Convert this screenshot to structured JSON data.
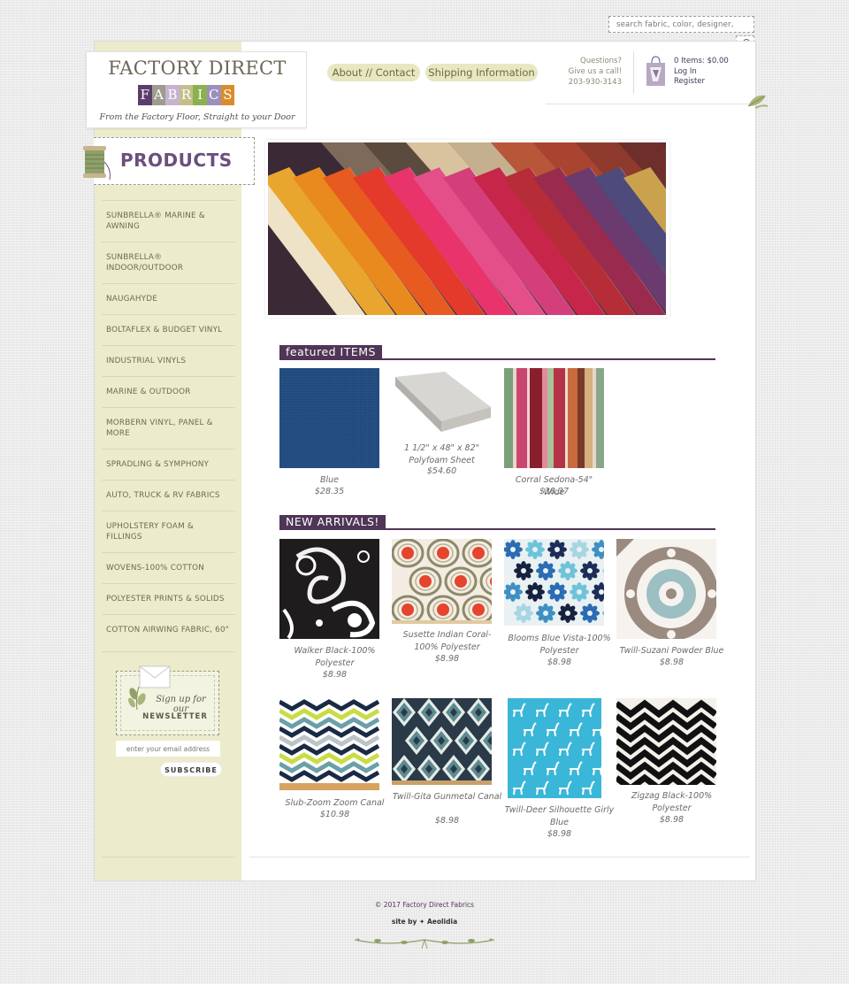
{
  "search": {
    "placeholder": "search fabric, color, designer,",
    "icon": "search-icon"
  },
  "logo": {
    "title": "FACTORY DIRECT",
    "letters": [
      "F",
      "A",
      "B",
      "R",
      "I",
      "C",
      "S"
    ],
    "letter_colors": [
      "#5b3d6b",
      "#9e9c8f",
      "#c7b3cf",
      "#c2c08a",
      "#8bb24c",
      "#9b8fbe",
      "#d98d2a"
    ],
    "tagline": "From the Factory Floor, Straight to your Door"
  },
  "nav": {
    "about": "About // Contact",
    "shipping": "Shipping Information"
  },
  "contact": {
    "line1": "Questions?",
    "line2": "Give us a call!",
    "phone": "203-930-3143"
  },
  "cart": {
    "summary": "0 Items: $0.00",
    "login": "Log In",
    "register": "Register",
    "icon": "shopping-bag-icon"
  },
  "products_heading": "PRODUCTS",
  "categories": [
    "SUNBRELLA® MARINE & AWNING",
    "SUNBRELLA® INDOOR/OUTDOOR",
    "NAUGAHYDE",
    "BOLTAFLEX & BUDGET VINYL",
    "INDUSTRIAL VINYLS",
    "MARINE & OUTDOOR",
    "MORBERN VINYL, PANEL & MORE",
    "SPRADLING & SYMPHONY",
    "AUTO, TRUCK & RV FABRICS",
    "UPHOLSTERY FOAM & FILLINGS",
    "WOVENS-100% COTTON",
    "POLYESTER PRINTS & SOLIDS",
    "COTTON AIRWING FABRIC, 60\""
  ],
  "newsletter": {
    "line1": "Sign up for our",
    "line2": "NEWSLETTER",
    "email_placeholder": "enter your email address",
    "subscribe": "SUBSCRIBE"
  },
  "featured": {
    "heading": "featured ITEMS",
    "items": [
      {
        "name": "Blue",
        "price": "$28.35"
      },
      {
        "name": "1 1/2\" x 48\" x 82\" Polyfoam Sheet",
        "price": "$54.60"
      },
      {
        "name": "Corral Sedona-54\" Wide",
        "price": "$38.37"
      }
    ]
  },
  "new_arrivals": {
    "heading": "NEW ARRIVALS!",
    "items": [
      {
        "name": "Walker Black-100% Polyester",
        "price": "$8.98"
      },
      {
        "name": "Susette Indian Coral-100% Polyester",
        "price": "$8.98"
      },
      {
        "name": "Blooms Blue Vista-100% Polyester",
        "price": "$8.98"
      },
      {
        "name": "Twill-Suzani Powder Blue",
        "price": "$8.98"
      },
      {
        "name": "Slub-Zoom Zoom Canal",
        "price": "$10.98"
      },
      {
        "name": "Twill-Gita Gunmetal Canal",
        "price": "$8.98"
      },
      {
        "name": "Twill-Deer Silhouette Girly Blue",
        "price": "$8.98"
      },
      {
        "name": "Zigzag Black-100% Polyester",
        "price": "$8.98"
      }
    ]
  },
  "footer": {
    "copyright": "© 2017 Factory Direct Fabrics",
    "site_by": "site by ✦ Aeolidia"
  },
  "colors": {
    "accent": "#4f3556",
    "sidebar": "#ecebcb",
    "pill": "#e7e7c3"
  }
}
